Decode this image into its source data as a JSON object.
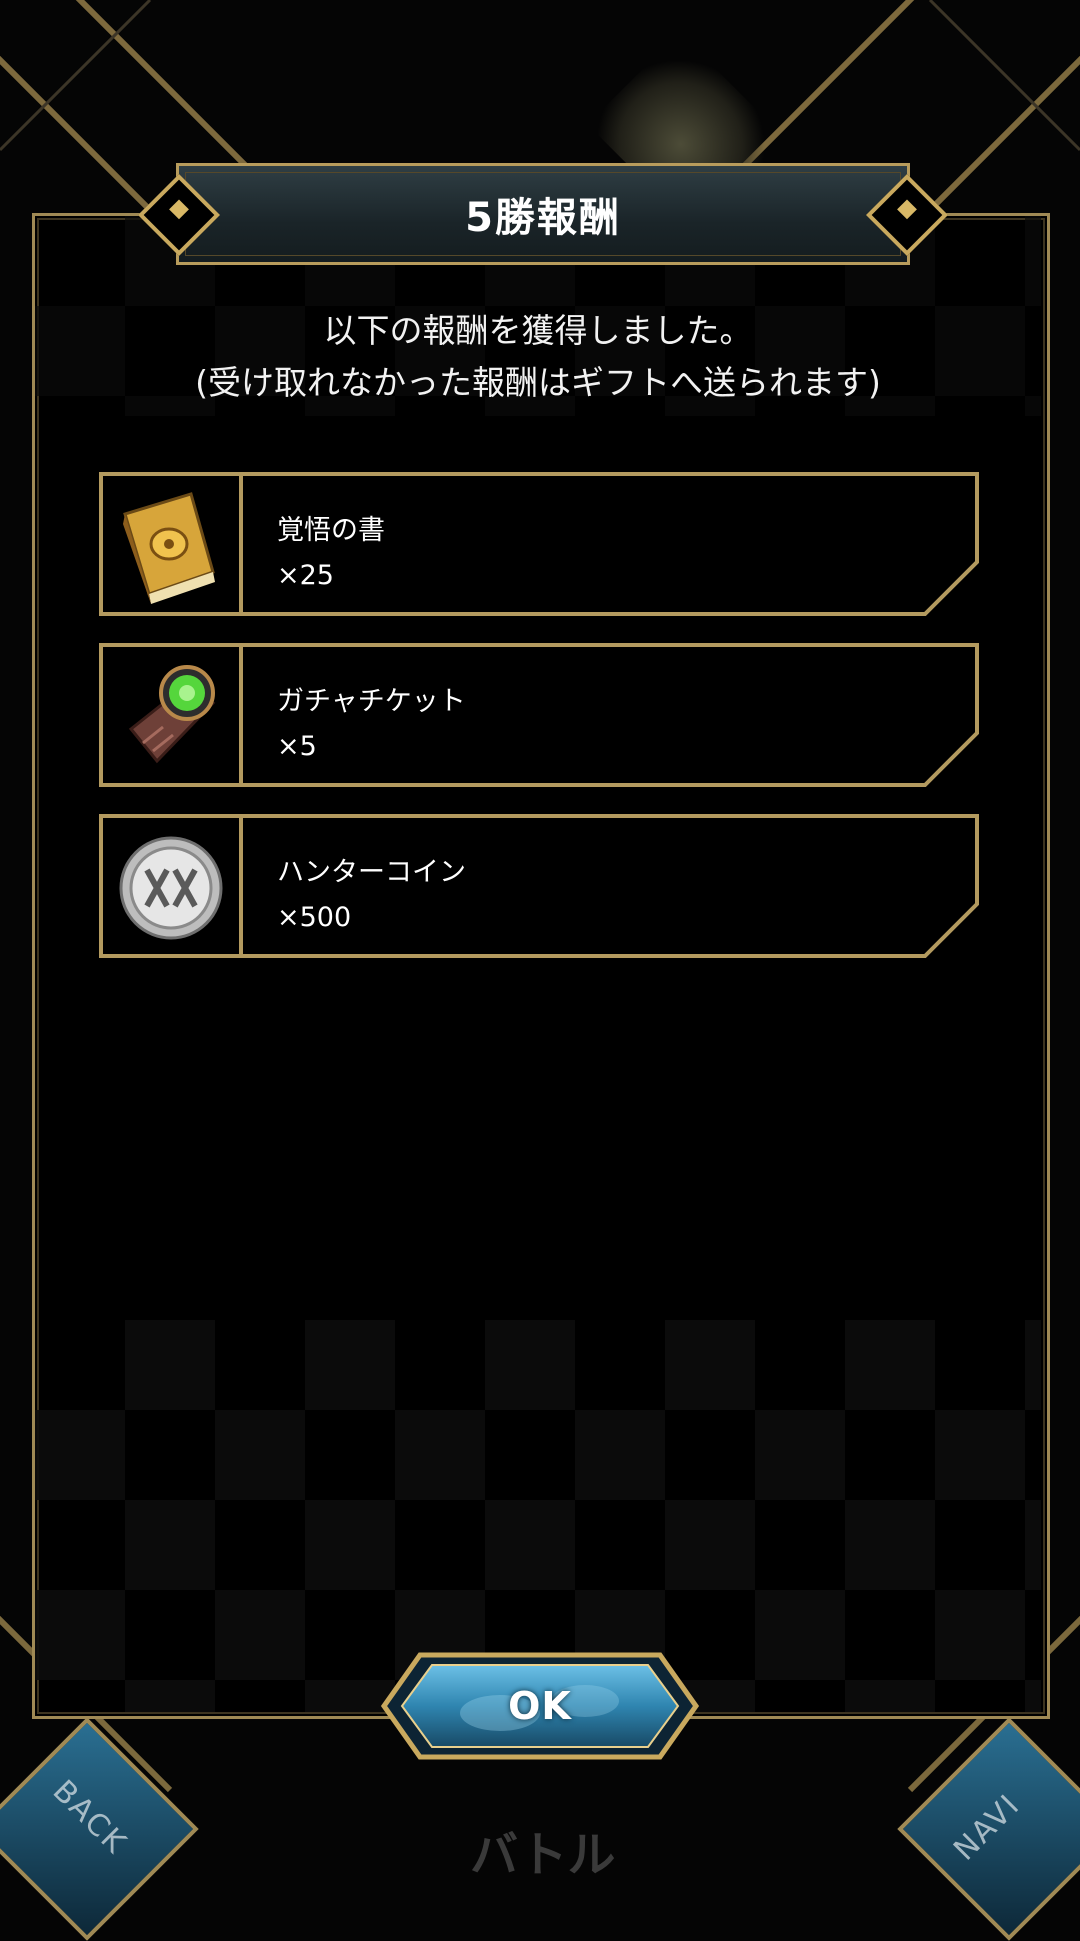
{
  "dialog": {
    "title": "5勝報酬",
    "message_line1": "以下の報酬を獲得しました。",
    "message_line2": "(受け取れなかった報酬はギフトへ送られます)",
    "ok_label": "OK"
  },
  "rewards": [
    {
      "name": "覚悟の書",
      "quantity": "×25",
      "icon": "book-icon"
    },
    {
      "name": "ガチャチケット",
      "quantity": "×5",
      "icon": "ticket-icon"
    },
    {
      "name": "ハンターコイン",
      "quantity": "×500",
      "icon": "coin-icon"
    }
  ],
  "bottom_nav": {
    "back_label": "BACK",
    "battle_label": "バトル",
    "navi_label": "NAVI"
  },
  "colors": {
    "gold": "#a08a55",
    "title_bar": "#1a2428",
    "ok_blue": "#3c8fb8"
  }
}
